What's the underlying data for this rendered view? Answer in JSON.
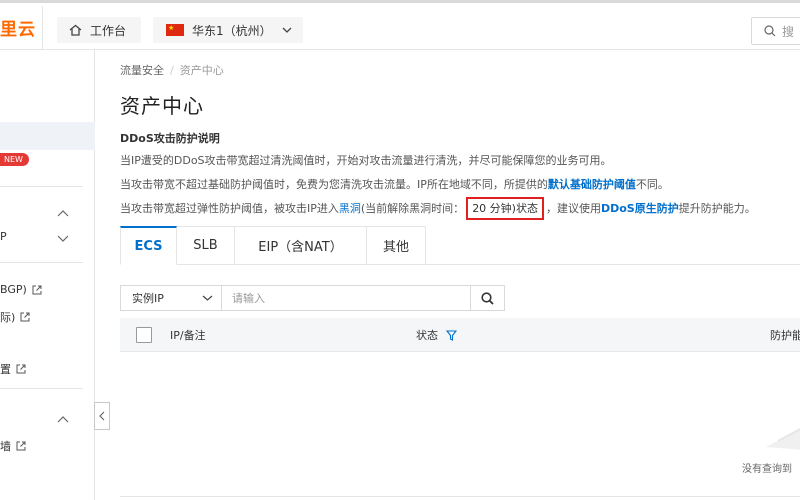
{
  "header": {
    "logo": "里云",
    "workbench_label": "工作台",
    "region_label": "华东1（杭州）",
    "search_placeholder": "搜"
  },
  "sidebar": {
    "new_badge": "NEW",
    "items": [
      {
        "label": "P"
      },
      {
        "label": "BGP)"
      },
      {
        "label": "际)"
      },
      {
        "label": "置"
      },
      {
        "label": "墙"
      }
    ]
  },
  "breadcrumb": {
    "parent": "流量安全",
    "separator": "/",
    "current": "资产中心"
  },
  "page_title": "资产中心",
  "info": {
    "heading": "DDoS攻击防护说明",
    "line1": "当IP遭受的DDoS攻击带宽超过清洗阈值时，开始对攻击流量进行清洗，并尽可能保障您的业务可用。",
    "line2_pre": "当攻击带宽不超过基础防护阈值时，免费为您清洗攻击流量。IP所在地域不同，所提供的",
    "line2_link": "默认基础防护阈值",
    "line2_post": "不同。",
    "line3_pre": "当攻击带宽超过弹性防护阈值，被攻击IP进入",
    "line3_link": "黑洞",
    "line3_mid": "(当前解除黑洞时间：",
    "line3_highlight": "20 分钟)状态",
    "line3_post1": "，建议使用",
    "line3_link2": "DDoS原生防护",
    "line3_post2": "提升防护能力。"
  },
  "tabs": [
    {
      "label": "ECS",
      "active": true
    },
    {
      "label": "SLB",
      "active": false
    },
    {
      "label": "EIP（含NAT）",
      "active": false
    },
    {
      "label": "其他",
      "active": false
    }
  ],
  "filter": {
    "select_value": "实例IP",
    "input_placeholder": "请输入"
  },
  "table": {
    "columns": [
      "IP/备注",
      "状态",
      "防护能"
    ],
    "empty_text": "没有查询到"
  },
  "colors": {
    "brand": "#ff6a00",
    "link": "#0070cc",
    "highlight_border": "#e02020",
    "badge": "#e53935"
  }
}
